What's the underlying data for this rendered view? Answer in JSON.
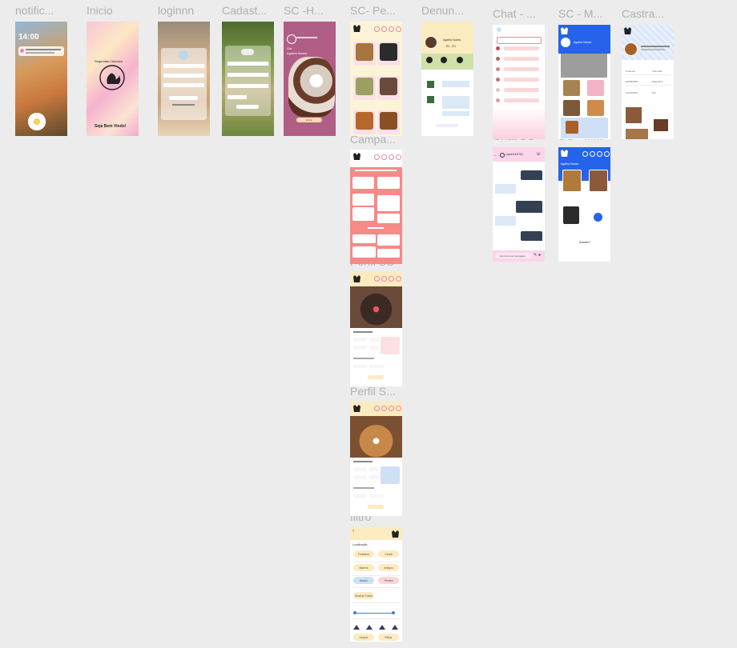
{
  "frames": {
    "notification": {
      "label": "notific...",
      "time": "14:00"
    },
    "inicio": {
      "label": "Inicio",
      "brand": "Segundas Chances",
      "welcome": "Seja Bem Vindo!"
    },
    "login": {
      "label": "loginnn"
    },
    "cadastro": {
      "label": "Cadast..."
    },
    "sc_home": {
      "label": "SC -H...",
      "greeting": "Olá",
      "user": "Agatha Nunes",
      "button": "Entrar"
    },
    "sc_pets": {
      "label": "SC- Pe..."
    },
    "denuncia": {
      "label": "Denun...",
      "user": "Agatha Nunes",
      "location": "RJ - RJ"
    },
    "chat_list": {
      "label": "Chat - ..."
    },
    "sc_map": {
      "label": "SC - M...",
      "user": "Agatha Nunes"
    },
    "castracao": {
      "label": "Castra...",
      "values": [
        "Cinamon",
        "Vira-Lata",
        "22/08/2018",
        "Masculino",
        "12/02/2022",
        "Sim"
      ]
    },
    "campanha": {
      "label": "Campa..."
    },
    "chat_sc": {
      "label": "Chat SC",
      "contact": "Lipe#1000761",
      "input_placeholder": "Escreva sua mensagem"
    },
    "sc_map2": {
      "label": "SC - M...",
      "user": "Agatha Nunes",
      "footer": "Adotar?"
    },
    "perfil_sc1": {
      "label": "Perfil SC"
    },
    "perfil_sc2": {
      "label": "Perfil S..."
    },
    "filtro": {
      "label": "filtro",
      "location_title": "Localização",
      "chips": [
        "Fortaleza",
        "Ceará",
        "Bairros",
        "Antigos",
        "Macho",
        "Fêmea",
        "Mostrar Todos"
      ],
      "clear": "Limpar",
      "filter": "Filtrar"
    }
  },
  "colors": {
    "canvas": "#ececec",
    "pink": "#f9dbe3",
    "yellow": "#fdebc0",
    "coral": "#f58a88",
    "blue": "#2563eb",
    "mauve": "#b05e86"
  }
}
